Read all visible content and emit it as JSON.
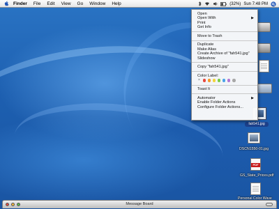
{
  "menubar": {
    "app_name": "Finder",
    "items": [
      "File",
      "Edit",
      "View",
      "Go",
      "Window",
      "Help"
    ],
    "battery": "(32%)",
    "clock": "Sun 7:48 PM"
  },
  "context_menu": {
    "group1": [
      "Open",
      "Open With",
      "Print",
      "Get Info"
    ],
    "group2": [
      "Move to Trash"
    ],
    "group3": [
      "Duplicate",
      "Make Alias",
      "Create Archive of \"fah541.jpg\"",
      "Slideshow"
    ],
    "group4": [
      "Copy \"fah541.jpg\""
    ],
    "color_label_title": "Color Label:",
    "color_labels": [
      "#e8473d",
      "#f39a2b",
      "#f2d43a",
      "#7ccb46",
      "#4aa3e8",
      "#b176d6",
      "#a8a8a8"
    ],
    "group5": [
      "Toast It"
    ],
    "group6": [
      "Automator",
      "Enable Folder Actions",
      "Configure Folder Actions..."
    ]
  },
  "desktop": {
    "selected_file": "fah541.jpg",
    "files": [
      "DSCN1550-01.jpg",
      "GS_State_Prices.pdf",
      "Personal Color Wave"
    ]
  },
  "window": {
    "title": "Message Board"
  }
}
